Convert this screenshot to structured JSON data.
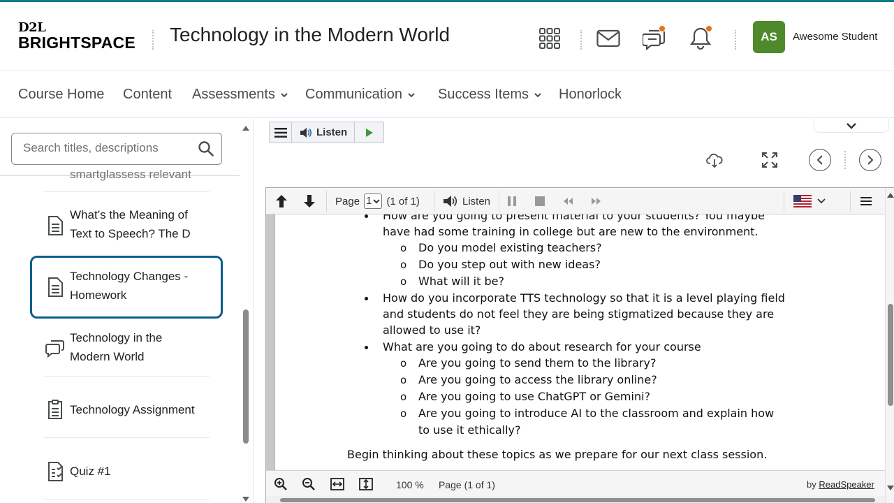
{
  "header": {
    "logo_top": "D2L",
    "logo_bottom": "BRIGHTSPACE",
    "course_title": "Technology in the Modern World",
    "user": {
      "initials": "AS",
      "name": "Awesome Student",
      "avatar_color": "#4e8a2b"
    },
    "icons": [
      "grid-icon",
      "mail-icon",
      "chat-icon",
      "bell-icon"
    ],
    "notification_color": "#e87511"
  },
  "nav": {
    "items": [
      {
        "label": "Course Home"
      },
      {
        "label": "Content"
      },
      {
        "label": "Assessments"
      },
      {
        "label": "Communication"
      },
      {
        "label": "Success Items"
      },
      {
        "label": "Honorlock"
      }
    ]
  },
  "sidebar": {
    "search_placeholder": "Search titles, descriptions",
    "partial_item": "smartglassess relevant",
    "items": [
      {
        "line1": "What’s the Meaning of",
        "line2": "Text to Speech? The D",
        "icon": "document-icon"
      },
      {
        "line1": "Technology Changes -",
        "line2": "Homework",
        "icon": "document-icon",
        "selected": true
      },
      {
        "line1": "Technology in the",
        "line2": "Modern World",
        "icon": "discussion-icon"
      },
      {
        "line1": "Technology Assignment",
        "icon": "assignment-icon"
      },
      {
        "line1": "Quiz #1",
        "icon": "quiz-icon"
      }
    ],
    "selected_color": "#0a5d8f"
  },
  "readspeaker": {
    "listen_label": "Listen"
  },
  "viewer": {
    "page_label": "Page",
    "page_value": "1",
    "page_of": "(1 of 1)",
    "listen_label": "Listen",
    "zoom": "100 %",
    "bottom_page": "Page (1 of 1)",
    "by_label": "by",
    "brand_link": "ReadSpeaker"
  },
  "document": {
    "lines": [
      {
        "kind": "bullet",
        "text": "How are you going to present material to your students?  You maybe"
      },
      {
        "kind": "cont1",
        "text": "have had some training in college but are new to the environment."
      },
      {
        "kind": "sub",
        "text": "Do you model existing teachers?"
      },
      {
        "kind": "sub",
        "text": "Do you step out with new ideas?"
      },
      {
        "kind": "sub",
        "text": "What will it be?"
      },
      {
        "kind": "bullet",
        "text": "How do you incorporate TTS technology so that it is a level playing field"
      },
      {
        "kind": "cont1",
        "text": "and students do not feel they are being stigmatized because they are"
      },
      {
        "kind": "cont1",
        "text": "allowed to use it?"
      },
      {
        "kind": "bullet",
        "text": "What are you going to do about research for your course"
      },
      {
        "kind": "sub",
        "text": "Are you going to send them to the library?"
      },
      {
        "kind": "sub",
        "text": "Are you going to access the library online?"
      },
      {
        "kind": "sub",
        "text": "Are you going to use ChatGPT or Gemini?"
      },
      {
        "kind": "sub",
        "text": "Are you going to introduce AI to the classroom and explain how"
      },
      {
        "kind": "cont2",
        "text": "to use it ethically?"
      },
      {
        "kind": "para",
        "text": "Begin thinking about these topics as we prepare for our next class session."
      }
    ],
    "sub_marker": "o"
  }
}
